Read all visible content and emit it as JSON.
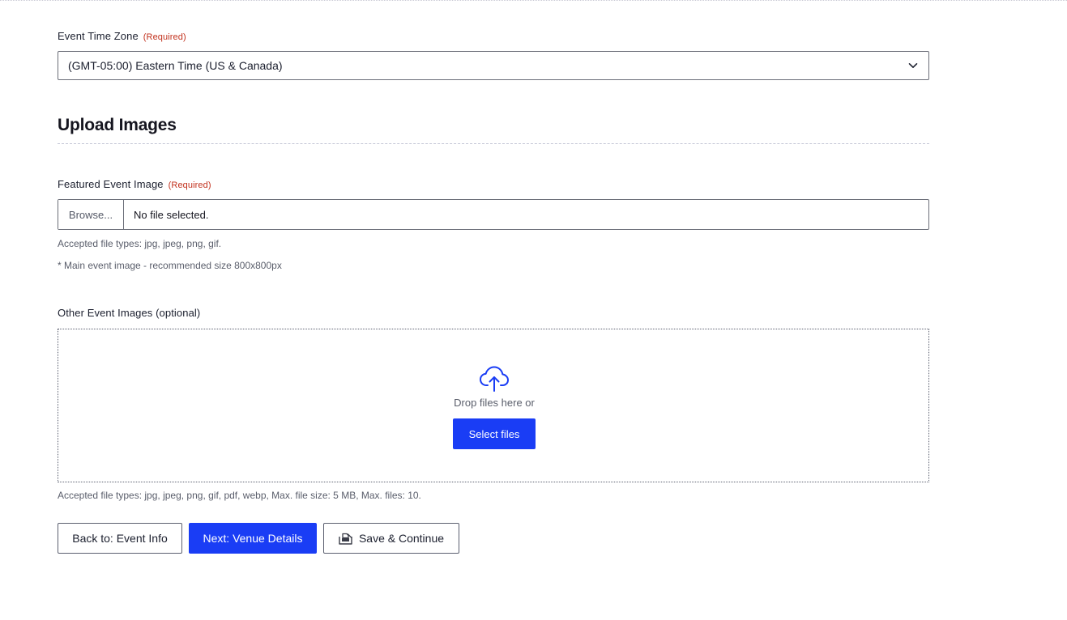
{
  "timezone": {
    "label": "Event Time Zone",
    "required_tag": "(Required)",
    "selected_value": "(GMT-05:00) Eastern Time (US & Canada)",
    "chevron_icon": "chevron-down-icon"
  },
  "upload_section": {
    "title": "Upload Images"
  },
  "featured_image": {
    "label": "Featured Event Image",
    "required_tag": "(Required)",
    "browse_label": "Browse...",
    "file_status": "No file selected.",
    "help_types": "Accepted file types: jpg, jpeg, png, gif.",
    "help_size": "* Main event image - recommended size 800x800px"
  },
  "other_images": {
    "label": "Other Event Images (optional)",
    "upload_icon": "cloud-upload-icon",
    "drop_text": "Drop files here or",
    "select_button": "Select files",
    "help_types": "Accepted file types: jpg, jpeg, png, gif, pdf, webp, Max. file size: 5 MB, Max. files: 10."
  },
  "actions": {
    "back_label": "Back to: Event Info",
    "next_label": "Next: Venue Details",
    "save_label": "Save & Continue",
    "save_icon": "save-continue-icon"
  },
  "colors": {
    "primary_blue": "#1a3df5",
    "required_red": "#c2311d",
    "help_text_gray": "#5a5e6b"
  }
}
